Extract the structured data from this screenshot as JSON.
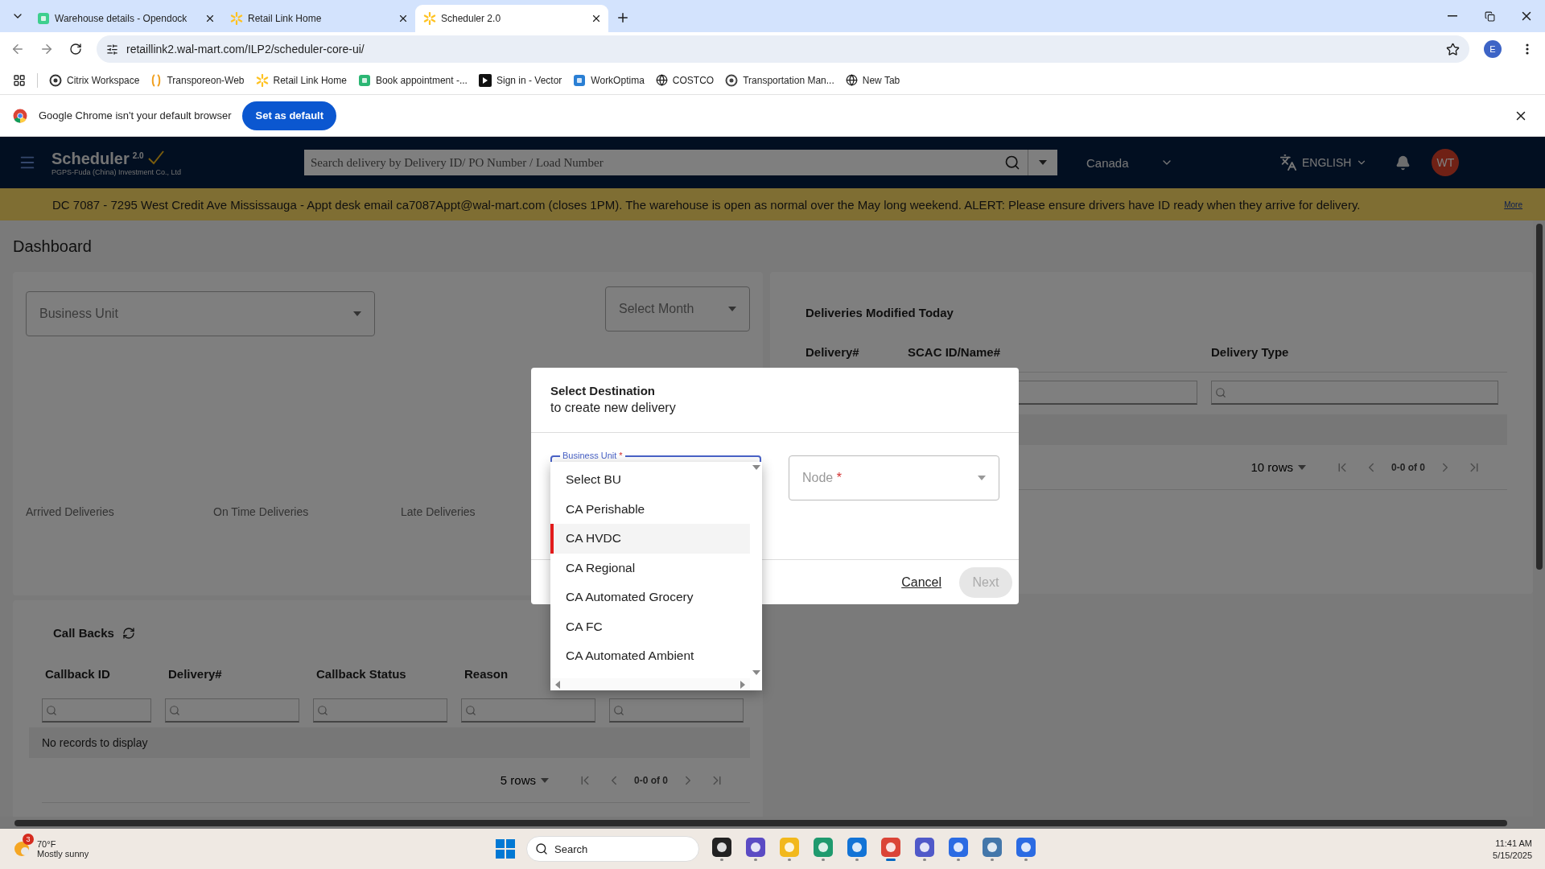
{
  "browser": {
    "tabs": [
      {
        "title": "Warehouse details - Opendock",
        "selected": false
      },
      {
        "title": "Retail Link Home",
        "selected": false
      },
      {
        "title": "Scheduler 2.0",
        "selected": true
      }
    ],
    "address": "retaillink2.wal-mart.com/ILP2/scheduler-core-ui/",
    "profile": "E",
    "bookmarks": [
      "Citrix Workspace",
      "Transporeon-Web",
      "Retail Link Home",
      "Book appointment -...",
      "Sign in - Vector",
      "WorkOptima",
      "COSTCO",
      "Transportation Man...",
      "New Tab"
    ],
    "infobar": {
      "message": "Google Chrome isn't your default browser",
      "button": "Set as default"
    }
  },
  "app": {
    "header": {
      "brand": "Scheduler",
      "version": "2.0",
      "company": "PGPS-Fuda (China) Investment Co., Ltd",
      "search_placeholder": "Search delivery by Delivery ID/ PO Number / Load Number",
      "country": "Canada",
      "language": "ENGLISH",
      "avatar": "WT"
    },
    "banner": {
      "text": "DC 7087 - 7295 West Credit Ave Mississauga - Appt desk email ca7087Appt@wal-mart.com (closes 1PM). The warehouse is open as normal over the May long weekend. ALERT: Please ensure drivers have ID ready when they arrive for delivery.",
      "more": "More"
    },
    "page_title": "Dashboard",
    "summary": {
      "business_unit_placeholder": "Business Unit",
      "month_placeholder": "Select Month",
      "stats": [
        "Arrived Deliveries",
        "On Time Deliveries",
        "Late Deliveries"
      ]
    },
    "modified_today": {
      "title": "Deliveries Modified Today",
      "columns": [
        "Delivery#",
        "SCAC ID/Name#",
        "Delivery Type"
      ],
      "pager": {
        "rows": "10 rows",
        "range": "0-0 of 0"
      }
    },
    "callbacks": {
      "title": "Call Backs",
      "columns": [
        "Callback ID",
        "Delivery#",
        "Callback Status",
        "Reason"
      ],
      "empty": "No records to display",
      "pager": {
        "rows": "5 rows",
        "range": "0-0 of 0"
      }
    },
    "modal": {
      "title": "Select Destination",
      "subtitle": "to create new delivery",
      "business_unit": {
        "label": "Business Unit",
        "required": "*",
        "expanded": true,
        "options": [
          {
            "label": "Select BU",
            "selected": false
          },
          {
            "label": "CA Perishable",
            "selected": false
          },
          {
            "label": "CA HVDC",
            "selected": true
          },
          {
            "label": "CA Regional",
            "selected": false
          },
          {
            "label": "CA Automated Grocery",
            "selected": false
          },
          {
            "label": "CA FC",
            "selected": false
          },
          {
            "label": "CA Automated Ambient",
            "selected": false
          }
        ]
      },
      "node": {
        "placeholder": "Node",
        "required": "*"
      },
      "cancel": "Cancel",
      "next": {
        "label": "Next",
        "disabled": true
      }
    }
  },
  "taskbar": {
    "weather": {
      "temp": "70°F",
      "condition": "Mostly sunny",
      "badge": "3"
    },
    "search_placeholder": "Search",
    "time": "11:41 AM",
    "date": "5/15/2025"
  }
}
